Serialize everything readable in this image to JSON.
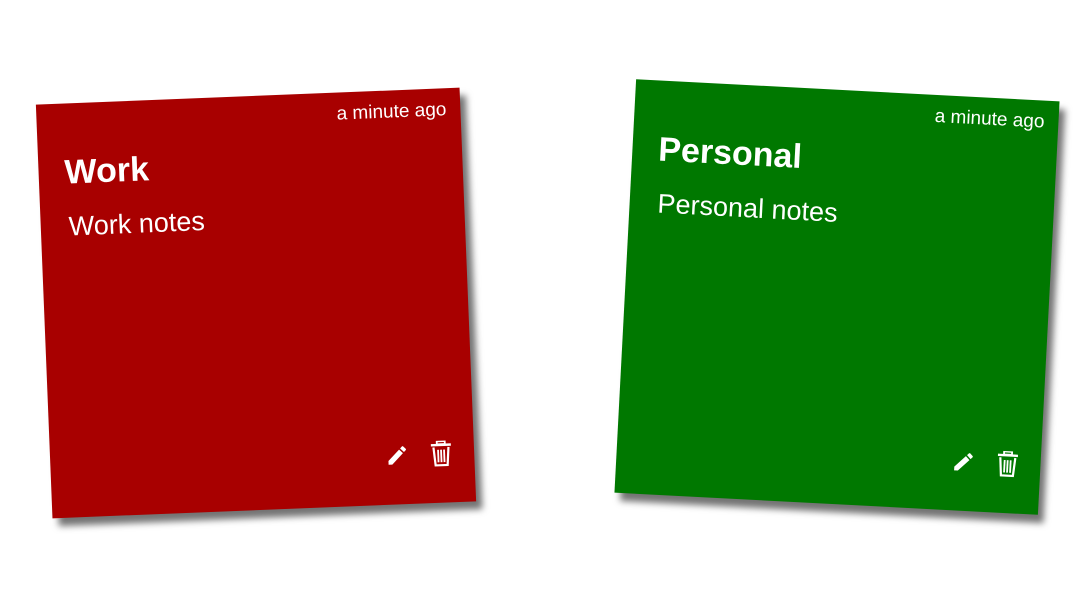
{
  "notes": [
    {
      "title": "Work",
      "body": "Work notes",
      "timestamp": "a minute ago",
      "color": "#a80000",
      "icons": {
        "edit": "pencil-icon",
        "delete": "trash-icon"
      }
    },
    {
      "title": "Personal",
      "body": "Personal notes",
      "timestamp": "a minute ago",
      "color": "#007800",
      "icons": {
        "edit": "pencil-icon",
        "delete": "trash-icon"
      }
    }
  ]
}
